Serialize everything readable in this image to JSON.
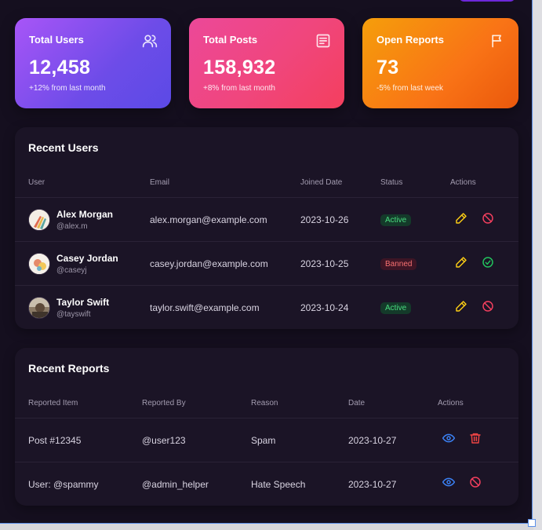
{
  "stats": [
    {
      "title": "Total Users",
      "value": "12,458",
      "change": "+12% from last month",
      "icon": "users-icon"
    },
    {
      "title": "Total Posts",
      "value": "158,932",
      "change": "+8% from last month",
      "icon": "document-icon"
    },
    {
      "title": "Open Reports",
      "value": "73",
      "change": "-5% from last week",
      "icon": "flag-icon"
    }
  ],
  "recent_users": {
    "title": "Recent Users",
    "columns": [
      "User",
      "Email",
      "Joined Date",
      "Status",
      "Actions"
    ],
    "rows": [
      {
        "name": "Alex Morgan",
        "handle": "@alex.m",
        "email": "alex.morgan@example.com",
        "joined": "2023-10-26",
        "status": "Active",
        "actions": [
          "edit-icon",
          "ban-icon"
        ]
      },
      {
        "name": "Casey Jordan",
        "handle": "@caseyj",
        "email": "casey.jordan@example.com",
        "joined": "2023-10-25",
        "status": "Banned",
        "actions": [
          "edit-icon",
          "unban-check-icon"
        ]
      },
      {
        "name": "Taylor Swift",
        "handle": "@tayswift",
        "email": "taylor.swift@example.com",
        "joined": "2023-10-24",
        "status": "Active",
        "actions": [
          "edit-icon",
          "ban-icon"
        ]
      }
    ]
  },
  "recent_reports": {
    "title": "Recent Reports",
    "columns": [
      "Reported Item",
      "Reported By",
      "Reason",
      "Date",
      "Actions"
    ],
    "rows": [
      {
        "item": "Post #12345",
        "by": "@user123",
        "reason": "Spam",
        "date": "2023-10-27",
        "actions": [
          "view-icon",
          "delete-icon"
        ]
      },
      {
        "item": "User: @spammy",
        "by": "@admin_helper",
        "reason": "Hate Speech",
        "date": "2023-10-27",
        "actions": [
          "view-icon",
          "ban-icon"
        ]
      }
    ]
  },
  "colors": {
    "background": "#150f1f",
    "panel": "#1b1426",
    "active": "#4ade80",
    "banned": "#f87171",
    "edit": "#facc15",
    "ban": "#f43f5e",
    "approve": "#22c55e",
    "view": "#3b82f6",
    "delete": "#ef4444"
  }
}
